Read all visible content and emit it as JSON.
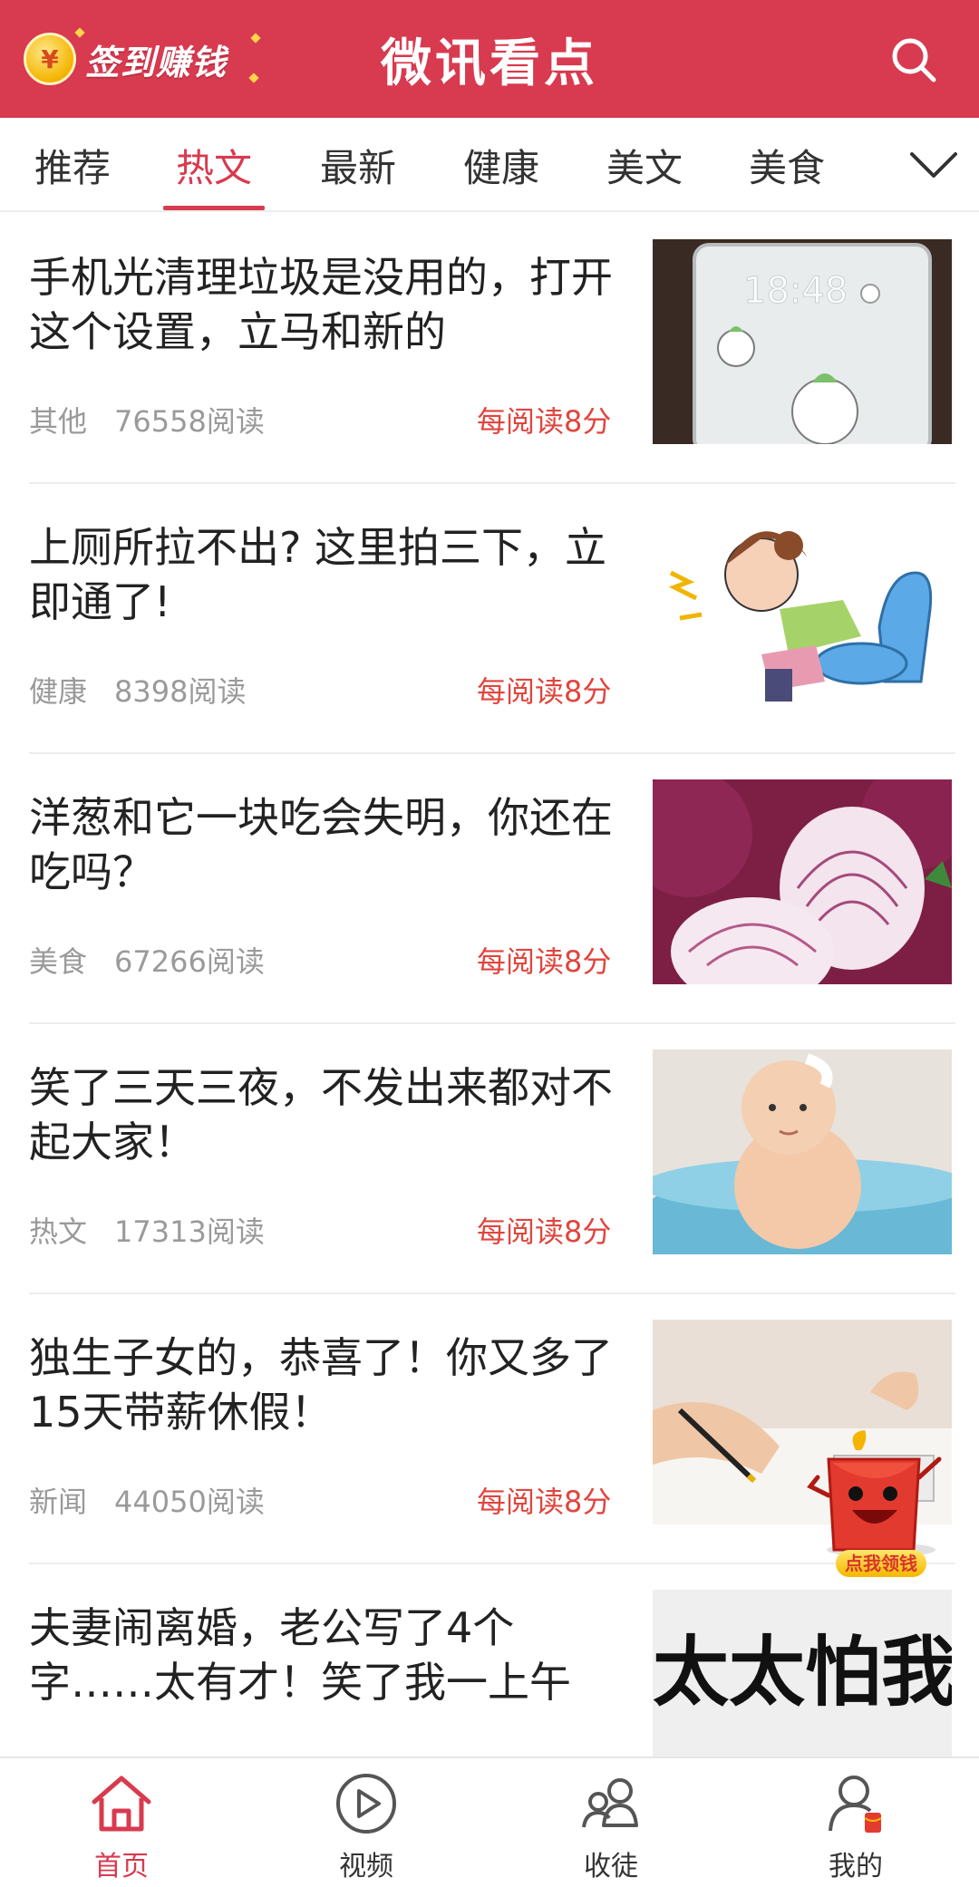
{
  "header": {
    "coin_symbol": "¥",
    "checkin_label": "签到赚钱",
    "app_title": "微讯看点",
    "accent_color": "#d83a4f"
  },
  "tabs": [
    {
      "label": "推荐",
      "active": false
    },
    {
      "label": "热文",
      "active": true
    },
    {
      "label": "最新",
      "active": false
    },
    {
      "label": "健康",
      "active": false
    },
    {
      "label": "美文",
      "active": false
    },
    {
      "label": "美食",
      "active": false
    }
  ],
  "articles": [
    {
      "title": "手机光清理垃圾是没用的，打开这个设置，立马和新的",
      "category": "其他",
      "reads": "76558阅读",
      "reward": "每阅读8分",
      "thumb": "phone-screen-photo"
    },
    {
      "title": "上厕所拉不出? 这里拍三下，立即通了!",
      "category": "健康",
      "reads": "8398阅读",
      "reward": "每阅读8分",
      "thumb": "toilet-cartoon"
    },
    {
      "title": "洋葱和它一块吃会失明，你还在吃吗？",
      "category": "美食",
      "reads": "67266阅读",
      "reward": "每阅读8分",
      "thumb": "red-onion-photo"
    },
    {
      "title": "笑了三天三夜，不发出来都对不起大家！",
      "category": "热文",
      "reads": "17313阅读",
      "reward": "每阅读8分",
      "thumb": "baby-bath-photo"
    },
    {
      "title": "独生子女的，恭喜了！你又多了15天带薪休假！",
      "category": "新闻",
      "reads": "44050阅读",
      "reward": "每阅读8分",
      "thumb": "writing-desk-photo"
    },
    {
      "title": "夫妻闹离婚，老公写了4个字……太有才！笑了我一上午",
      "category": "",
      "reads": "",
      "reward": "",
      "thumb": "calligraphy-photo"
    }
  ],
  "promo_badge": {
    "label": "点我领钱"
  },
  "bottom_nav": [
    {
      "label": "首页",
      "icon": "home-icon",
      "active": true
    },
    {
      "label": "视频",
      "icon": "play-icon",
      "active": false
    },
    {
      "label": "收徒",
      "icon": "users-icon",
      "active": false
    },
    {
      "label": "我的",
      "icon": "user-icon",
      "active": false
    }
  ]
}
